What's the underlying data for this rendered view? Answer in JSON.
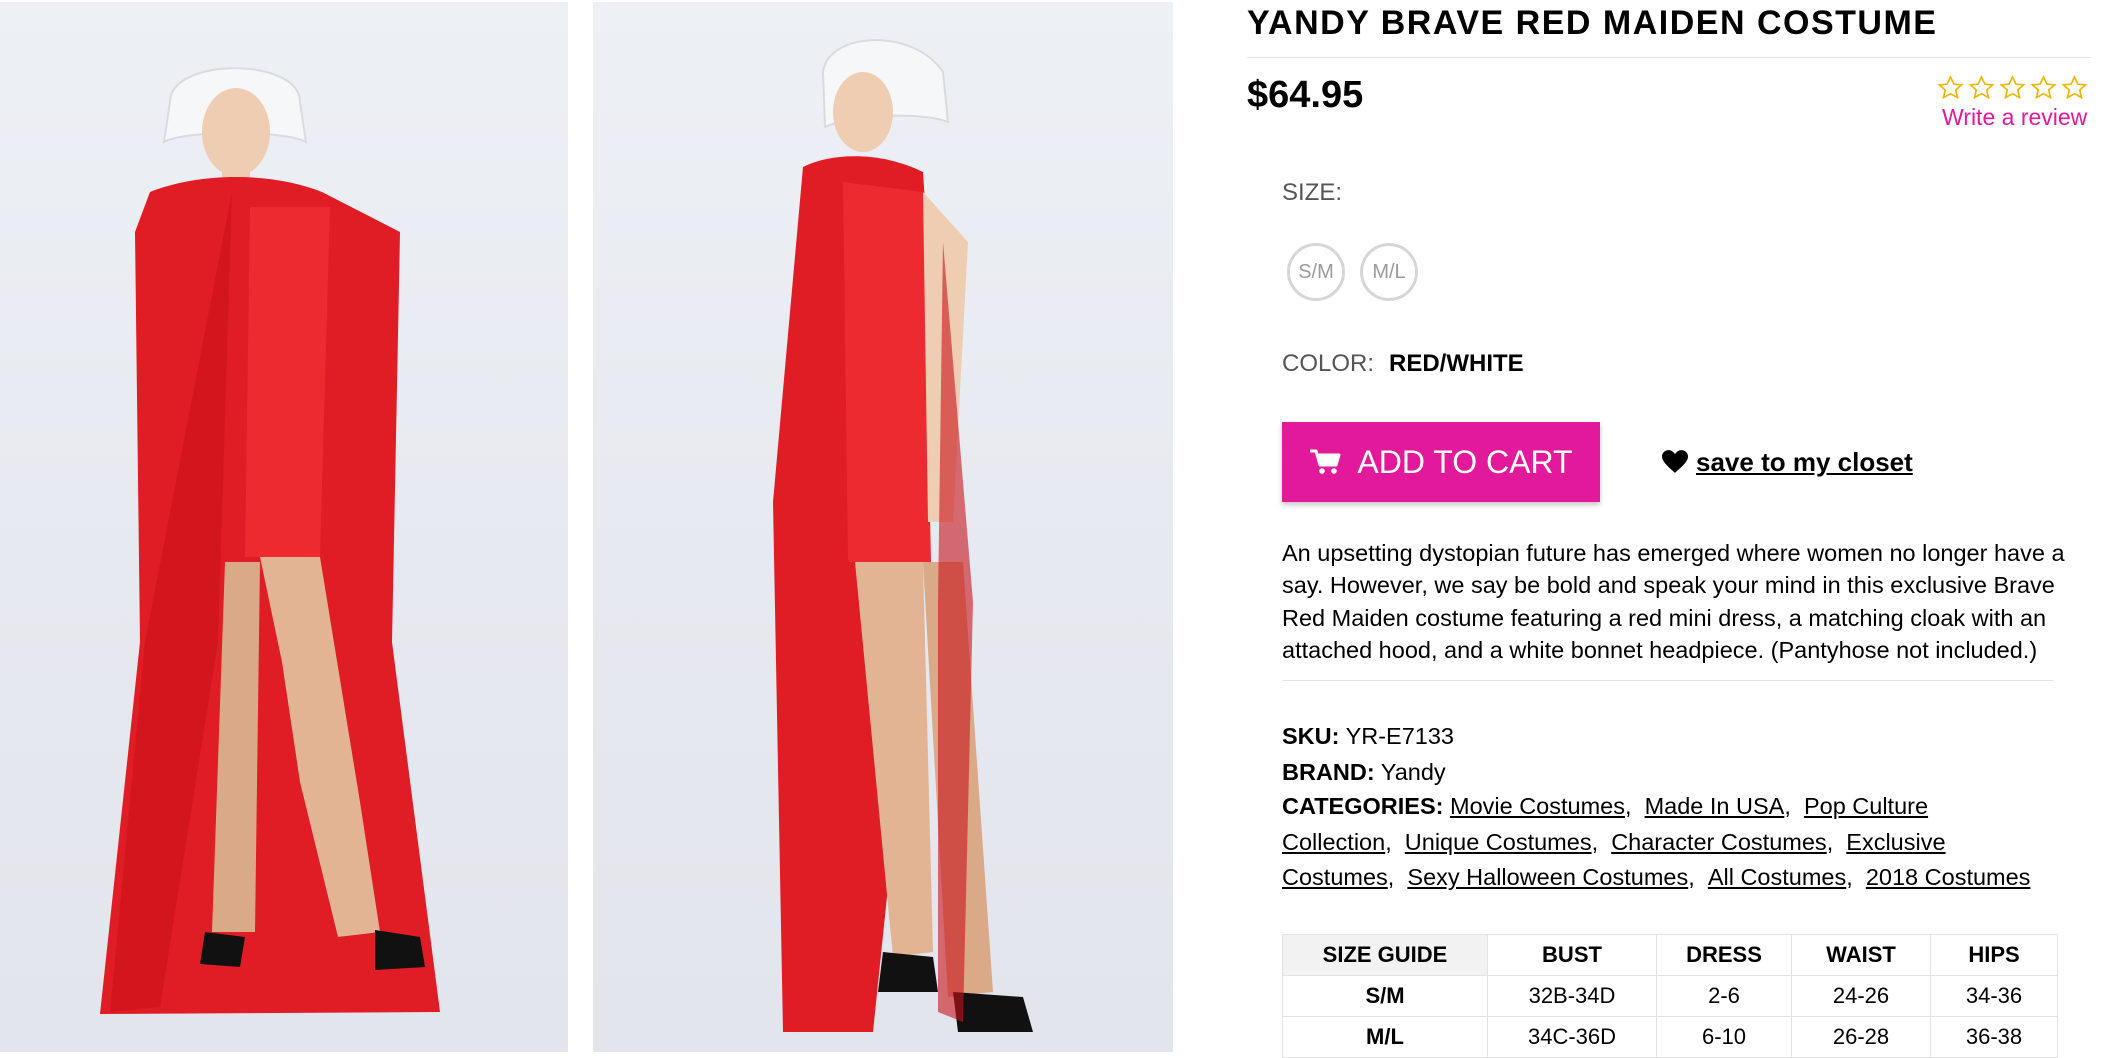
{
  "product": {
    "title": "YANDY BRAVE RED MAIDEN COSTUME",
    "price": "$64.95",
    "rating_stars": 0,
    "review_link": "Write a review",
    "size_label": "SIZE:",
    "sizes": [
      "S/M",
      "M/L"
    ],
    "color_label": "COLOR:",
    "color_value": "RED/WHITE",
    "add_to_cart": "ADD TO CART",
    "save_closet": "save to my closet",
    "description": "An upsetting dystopian future has emerged where women no longer have a say. However, we say be bold and speak your mind in this exclusive Brave Red Maiden costume featuring a red mini dress, a matching cloak with an attached hood, and a white bonnet headpiece. (Pantyhose not included.)"
  },
  "meta": {
    "sku_label": "SKU:",
    "sku": "YR-E7133",
    "brand_label": "BRAND:",
    "brand": "Yandy",
    "categories_label": "CATEGORIES:",
    "categories": [
      "Movie Costumes",
      "Made In USA",
      "Pop Culture Collection",
      "Unique Costumes",
      "Character Costumes",
      "Exclusive Costumes",
      "Sexy Halloween Costumes",
      "All Costumes",
      "2018 Costumes"
    ]
  },
  "size_guide": {
    "headers": [
      "SIZE GUIDE",
      "BUST",
      "DRESS",
      "WAIST",
      "HIPS"
    ],
    "rows": [
      [
        "S/M",
        "32B-34D",
        "2-6",
        "24-26",
        "34-36"
      ],
      [
        "M/L",
        "34C-36D",
        "6-10",
        "26-28",
        "36-38"
      ]
    ]
  },
  "colors": {
    "accent": "#e3199b",
    "star": "#f0b400",
    "garment": "#e01c24"
  }
}
